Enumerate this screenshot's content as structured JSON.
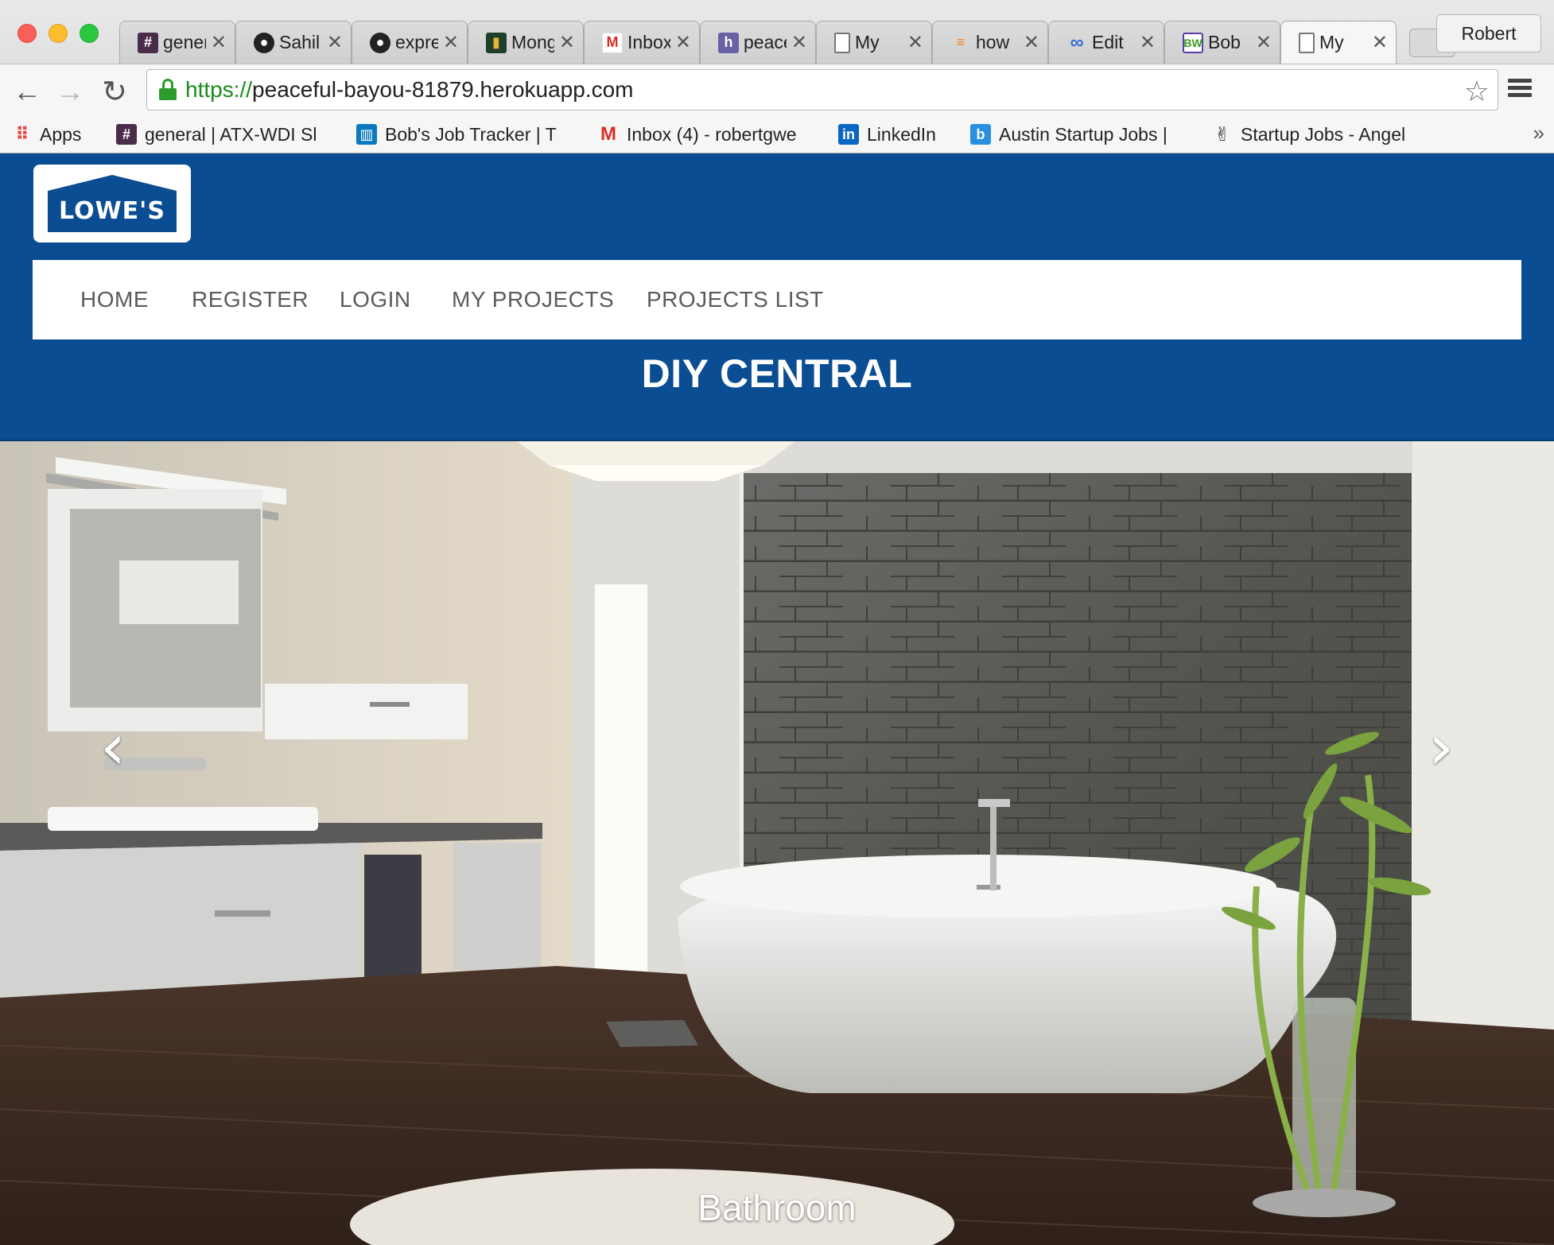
{
  "browser": {
    "tabs": [
      {
        "title": "general",
        "icon": "slack-hash-icon",
        "color": "#4a2b4a"
      },
      {
        "title": "Sahil",
        "icon": "github-icon",
        "color": "#222222"
      },
      {
        "title": "express",
        "icon": "github-icon",
        "color": "#222222"
      },
      {
        "title": "Mongo",
        "icon": "mongo-icon",
        "color": "#1f3f2a"
      },
      {
        "title": "Inbox",
        "icon": "gmail-icon",
        "color": "#d93025"
      },
      {
        "title": "peaceful",
        "icon": "heroku-icon",
        "color": "#6762a6"
      },
      {
        "title": "My",
        "icon": "page-icon",
        "color": "#ffffff"
      },
      {
        "title": "how",
        "icon": "stackoverflow-icon",
        "color": "#f48024"
      },
      {
        "title": "Edit",
        "icon": "infinity-icon",
        "color": "#3b6fd6"
      },
      {
        "title": "Bob",
        "icon": "bw-icon",
        "color": "#3a9d23"
      },
      {
        "title": "My",
        "icon": "page-icon",
        "color": "#ffffff",
        "active": true
      }
    ],
    "profile_name": "Robert",
    "url_scheme": "https://",
    "url_host": "peaceful-bayou-81879.herokuapp.com",
    "bookmarks": [
      {
        "label": "Apps",
        "icon": "apps-grid-icon"
      },
      {
        "label": "general | ATX-WDI Sl",
        "icon": "slack-hash-icon"
      },
      {
        "label": "Bob's Job Tracker | T",
        "icon": "trello-icon"
      },
      {
        "label": "Inbox (4) - robertgwe",
        "icon": "gmail-icon"
      },
      {
        "label": "LinkedIn",
        "icon": "linkedin-icon"
      },
      {
        "label": "Austin Startup Jobs |",
        "icon": "builtin-icon"
      },
      {
        "label": "Startup Jobs - Angel",
        "icon": "angellist-icon"
      }
    ],
    "bookmarks_overflow": "»"
  },
  "site": {
    "logo_text": "LOWE'S",
    "nav": [
      "HOME",
      "REGISTER",
      "LOGIN",
      "MY PROJECTS",
      "PROJECTS LIST"
    ],
    "title": "DIY CENTRAL",
    "brand_color": "#0a4d92"
  },
  "carousel": {
    "caption": "Bathroom",
    "prev_symbol": "‹",
    "next_symbol": "›"
  }
}
